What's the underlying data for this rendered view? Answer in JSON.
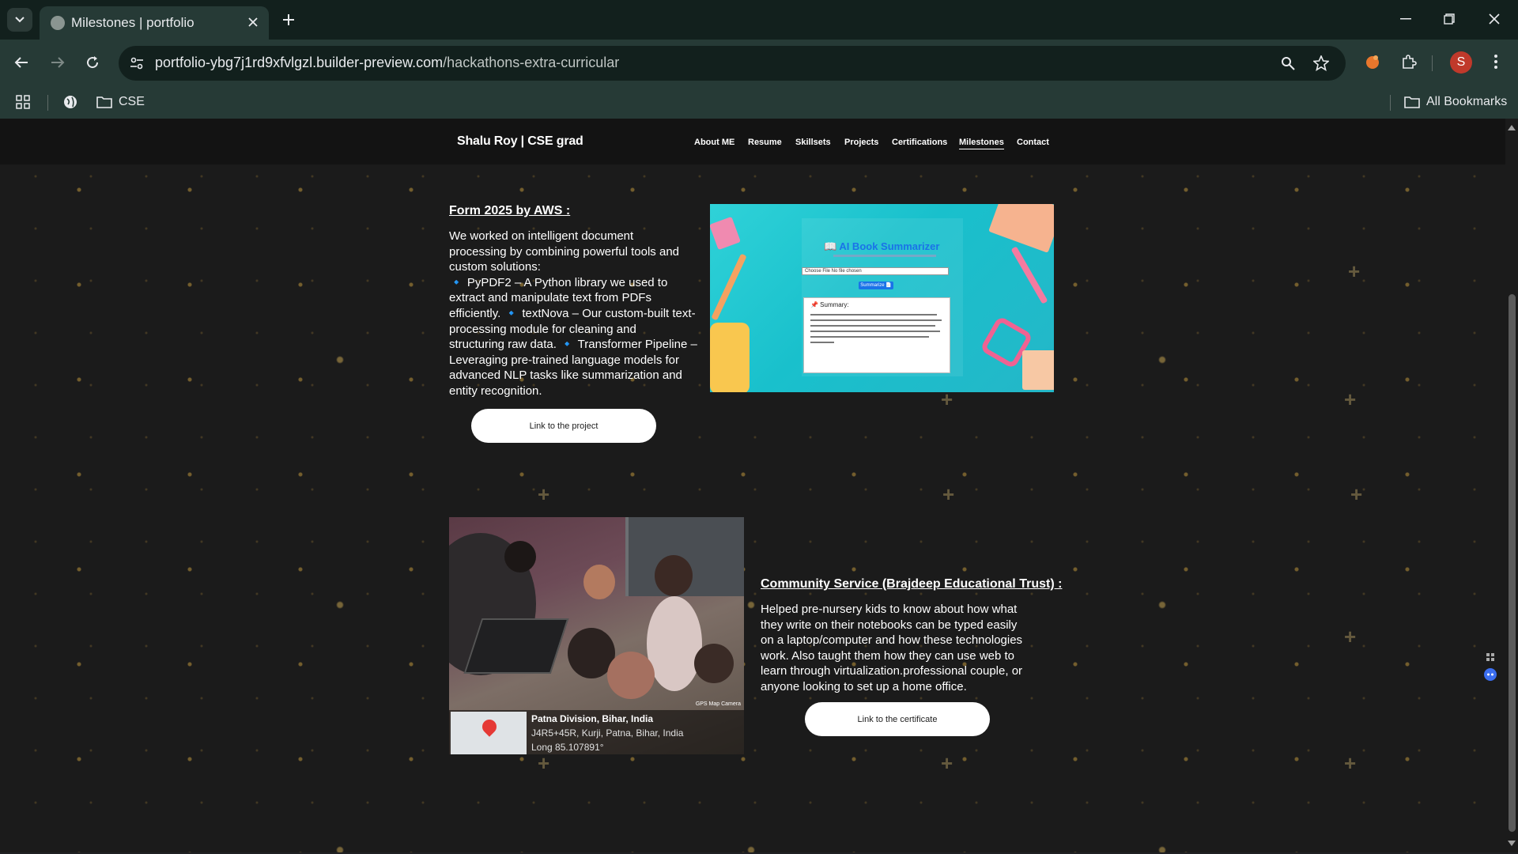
{
  "browser": {
    "tab_title": "Milestones | portfolio",
    "url_host": "portfolio-ybg7j1rd9xfvlgzl.builder-preview.com",
    "url_path": "/hackathons-extra-curricular",
    "profile_initial": "S",
    "bookmarks": {
      "folder": "CSE",
      "all": "All Bookmarks"
    }
  },
  "site": {
    "brand": "Shalu Roy | CSE grad",
    "nav": [
      "About ME",
      "Resume",
      "Skillsets",
      "Projects",
      "Certifications",
      "Milestones",
      "Contact"
    ],
    "active_nav": "Milestones"
  },
  "aws": {
    "title": "Form 2025 by AWS :",
    "lines": [
      "We worked on intelligent document",
      "processing by combining powerful tools and",
      "custom solutions:",
      "🔹 PyPDF2 – A Python library we used to",
      "extract and manipulate text from PDFs",
      "efficiently. 🔹 textNova – Our custom-built text-",
      "processing module for cleaning and",
      "structuring raw data. 🔹 Transformer Pipeline –",
      "Leveraging pre-trained language models for",
      "advanced NLP tasks like summarization and",
      "entity recognition."
    ],
    "button": "Link to the project",
    "app": {
      "title": "📖 AI Book Summarizer",
      "file_label": "Choose File   No file chosen",
      "button": "Summarize 📄",
      "summary_label": "📌 Summary:"
    }
  },
  "community": {
    "title": "Community Service (Brajdeep Educational Trust) :",
    "lines": [
      "Helped pre-nursery kids to know about how what",
      "they write on their notebooks can be typed easily",
      "on a laptop/computer and how these technologies",
      "work. Also taught them how they can use web to",
      "learn through virtualization.professional couple, or",
      "anyone looking to set up a home office."
    ],
    "button": "Link to the certificate",
    "photo": {
      "location": "Patna Division, Bihar, India",
      "address": "J4R5+45R, Kurji, Patna, Bihar, India",
      "coords": "Long 85.107891°",
      "stamp": "GPS Map Camera"
    }
  },
  "colors": {
    "accent_gold": "#c9a24e",
    "chrome_dark": "#12201d",
    "chrome": "#263a36",
    "page_bg": "#1b1b1b"
  }
}
